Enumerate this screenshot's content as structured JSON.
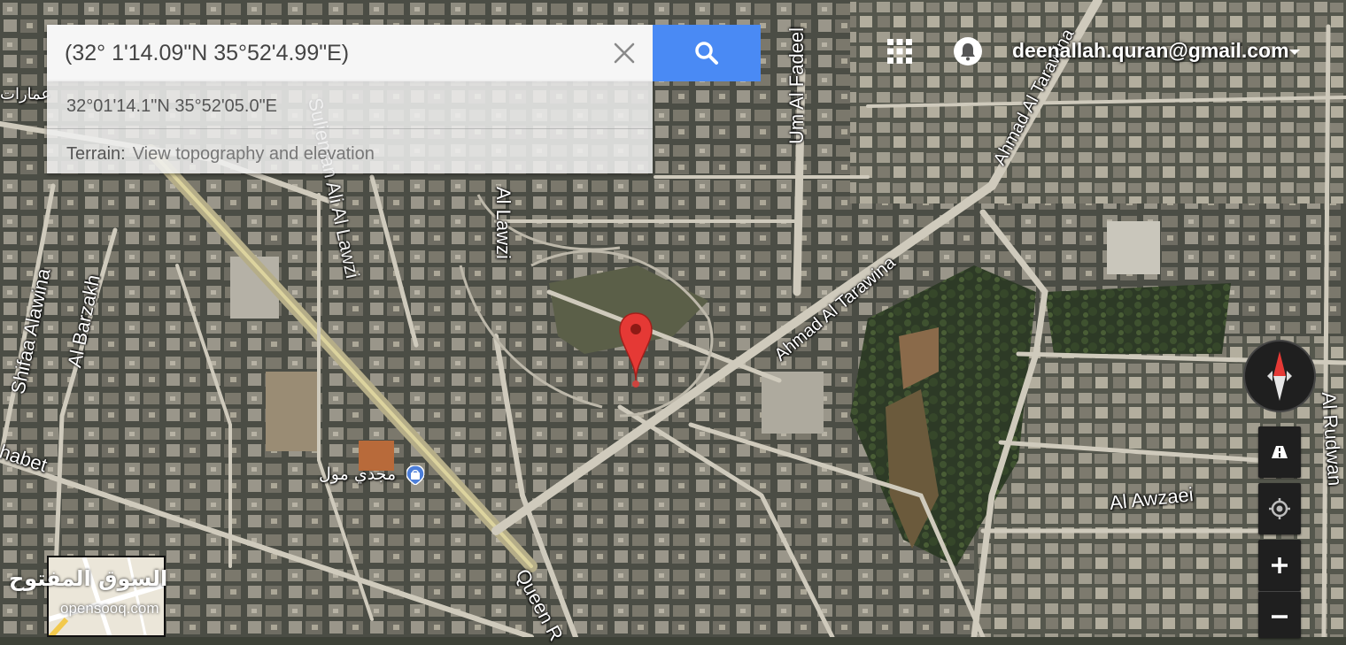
{
  "search": {
    "query": "(32° 1'14.09\"N 35°52'4.99\"E)"
  },
  "suggestions": {
    "coords": "32°01'14.1\"N 35°52'05.0\"E",
    "terrain_label": "Terrain:",
    "terrain_desc": "View topography and elevation"
  },
  "header": {
    "account_email": "deenallah.quran@gmail.com"
  },
  "streets": {
    "um_al_fadeel": "Um Al Fadeel",
    "ahmad_al_tarawina_upper": "Ahmad Al Tarawina",
    "ahmad_al_tarawina_lower": "Ahmad Al Tarawina",
    "al_lawzi_1": "Al Lawzi",
    "al_lawzi_2": "Sulieman Ali Al Lawzi",
    "shifaa_alawina": "Shifaa Alawina",
    "al_barzakh": "Al Barzakh",
    "queen_rania": "Queen R",
    "al_awzaei": "Al Awzaei",
    "al_rudwan": "Al Rudwan",
    "shabet": "habet",
    "left_edge_arabic": "عمارات"
  },
  "poi": {
    "mall": "مجدي مول"
  },
  "watermark": {
    "arabic": "السوق المفتوح",
    "latin": "opensooq.com"
  },
  "icons": {
    "search": "search-icon",
    "clear": "close-icon",
    "apps": "apps-grid-icon",
    "notifications": "bell-icon",
    "compass": "compass-icon",
    "earth": "road-view-icon",
    "location": "my-location-icon",
    "zoom_in": "plus-icon",
    "zoom_out": "minus-icon",
    "pin": "map-pin-icon"
  },
  "colors": {
    "search_button": "#4a8af4",
    "pin": "#e53935"
  }
}
